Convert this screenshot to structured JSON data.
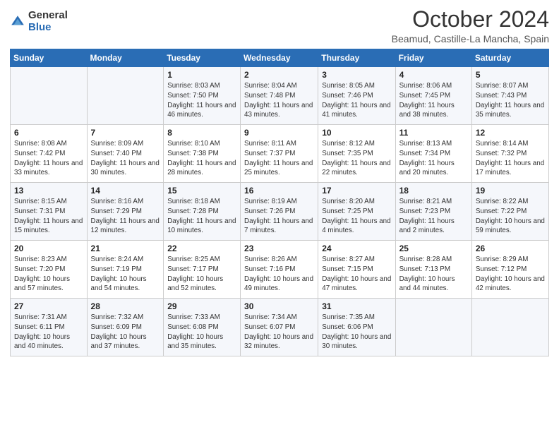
{
  "logo": {
    "general": "General",
    "blue": "Blue"
  },
  "title": "October 2024",
  "location": "Beamud, Castille-La Mancha, Spain",
  "days_of_week": [
    "Sunday",
    "Monday",
    "Tuesday",
    "Wednesday",
    "Thursday",
    "Friday",
    "Saturday"
  ],
  "weeks": [
    [
      {
        "day": "",
        "info": ""
      },
      {
        "day": "",
        "info": ""
      },
      {
        "day": "1",
        "info": "Sunrise: 8:03 AM\nSunset: 7:50 PM\nDaylight: 11 hours and 46 minutes."
      },
      {
        "day": "2",
        "info": "Sunrise: 8:04 AM\nSunset: 7:48 PM\nDaylight: 11 hours and 43 minutes."
      },
      {
        "day": "3",
        "info": "Sunrise: 8:05 AM\nSunset: 7:46 PM\nDaylight: 11 hours and 41 minutes."
      },
      {
        "day": "4",
        "info": "Sunrise: 8:06 AM\nSunset: 7:45 PM\nDaylight: 11 hours and 38 minutes."
      },
      {
        "day": "5",
        "info": "Sunrise: 8:07 AM\nSunset: 7:43 PM\nDaylight: 11 hours and 35 minutes."
      }
    ],
    [
      {
        "day": "6",
        "info": "Sunrise: 8:08 AM\nSunset: 7:42 PM\nDaylight: 11 hours and 33 minutes."
      },
      {
        "day": "7",
        "info": "Sunrise: 8:09 AM\nSunset: 7:40 PM\nDaylight: 11 hours and 30 minutes."
      },
      {
        "day": "8",
        "info": "Sunrise: 8:10 AM\nSunset: 7:38 PM\nDaylight: 11 hours and 28 minutes."
      },
      {
        "day": "9",
        "info": "Sunrise: 8:11 AM\nSunset: 7:37 PM\nDaylight: 11 hours and 25 minutes."
      },
      {
        "day": "10",
        "info": "Sunrise: 8:12 AM\nSunset: 7:35 PM\nDaylight: 11 hours and 22 minutes."
      },
      {
        "day": "11",
        "info": "Sunrise: 8:13 AM\nSunset: 7:34 PM\nDaylight: 11 hours and 20 minutes."
      },
      {
        "day": "12",
        "info": "Sunrise: 8:14 AM\nSunset: 7:32 PM\nDaylight: 11 hours and 17 minutes."
      }
    ],
    [
      {
        "day": "13",
        "info": "Sunrise: 8:15 AM\nSunset: 7:31 PM\nDaylight: 11 hours and 15 minutes."
      },
      {
        "day": "14",
        "info": "Sunrise: 8:16 AM\nSunset: 7:29 PM\nDaylight: 11 hours and 12 minutes."
      },
      {
        "day": "15",
        "info": "Sunrise: 8:18 AM\nSunset: 7:28 PM\nDaylight: 11 hours and 10 minutes."
      },
      {
        "day": "16",
        "info": "Sunrise: 8:19 AM\nSunset: 7:26 PM\nDaylight: 11 hours and 7 minutes."
      },
      {
        "day": "17",
        "info": "Sunrise: 8:20 AM\nSunset: 7:25 PM\nDaylight: 11 hours and 4 minutes."
      },
      {
        "day": "18",
        "info": "Sunrise: 8:21 AM\nSunset: 7:23 PM\nDaylight: 11 hours and 2 minutes."
      },
      {
        "day": "19",
        "info": "Sunrise: 8:22 AM\nSunset: 7:22 PM\nDaylight: 10 hours and 59 minutes."
      }
    ],
    [
      {
        "day": "20",
        "info": "Sunrise: 8:23 AM\nSunset: 7:20 PM\nDaylight: 10 hours and 57 minutes."
      },
      {
        "day": "21",
        "info": "Sunrise: 8:24 AM\nSunset: 7:19 PM\nDaylight: 10 hours and 54 minutes."
      },
      {
        "day": "22",
        "info": "Sunrise: 8:25 AM\nSunset: 7:17 PM\nDaylight: 10 hours and 52 minutes."
      },
      {
        "day": "23",
        "info": "Sunrise: 8:26 AM\nSunset: 7:16 PM\nDaylight: 10 hours and 49 minutes."
      },
      {
        "day": "24",
        "info": "Sunrise: 8:27 AM\nSunset: 7:15 PM\nDaylight: 10 hours and 47 minutes."
      },
      {
        "day": "25",
        "info": "Sunrise: 8:28 AM\nSunset: 7:13 PM\nDaylight: 10 hours and 44 minutes."
      },
      {
        "day": "26",
        "info": "Sunrise: 8:29 AM\nSunset: 7:12 PM\nDaylight: 10 hours and 42 minutes."
      }
    ],
    [
      {
        "day": "27",
        "info": "Sunrise: 7:31 AM\nSunset: 6:11 PM\nDaylight: 10 hours and 40 minutes."
      },
      {
        "day": "28",
        "info": "Sunrise: 7:32 AM\nSunset: 6:09 PM\nDaylight: 10 hours and 37 minutes."
      },
      {
        "day": "29",
        "info": "Sunrise: 7:33 AM\nSunset: 6:08 PM\nDaylight: 10 hours and 35 minutes."
      },
      {
        "day": "30",
        "info": "Sunrise: 7:34 AM\nSunset: 6:07 PM\nDaylight: 10 hours and 32 minutes."
      },
      {
        "day": "31",
        "info": "Sunrise: 7:35 AM\nSunset: 6:06 PM\nDaylight: 10 hours and 30 minutes."
      },
      {
        "day": "",
        "info": ""
      },
      {
        "day": "",
        "info": ""
      }
    ]
  ]
}
